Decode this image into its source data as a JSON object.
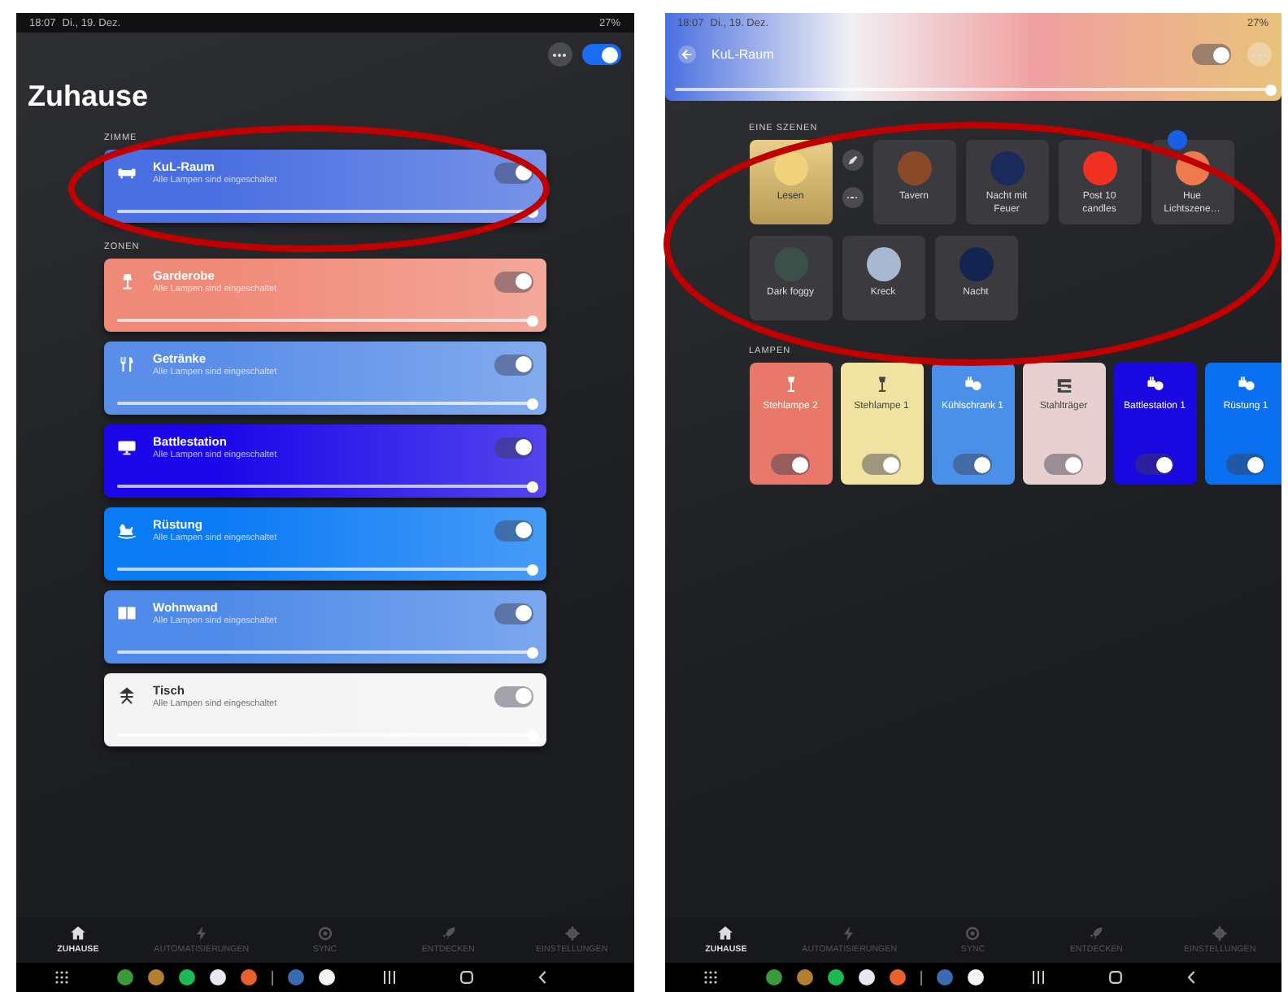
{
  "home": {
    "status_bar": {
      "time": "18:07",
      "date": "Di., 19. Dez.",
      "battery": "27%"
    },
    "title": "Zuhause",
    "all_on": true,
    "sections": [
      {
        "label": "ZIMME",
        "rooms": [
          {
            "name": "KuL-Raum",
            "subtitle": "Alle Lampen sind eingeschaltet",
            "on": true,
            "level": 1,
            "color": "#4a6fe0"
          }
        ]
      },
      {
        "label": "ZONEN",
        "rooms": [
          {
            "name": "Garderobe",
            "subtitle": "Alle Lampen sind eingeschaltet",
            "on": true,
            "level": 1,
            "color": "#f08a78"
          },
          {
            "name": "Getränke",
            "subtitle": "Alle Lampen sind eingeschaltet",
            "on": true,
            "level": 1,
            "color": "#5a8ee8"
          },
          {
            "name": "Battlestation",
            "subtitle": "Alle Lampen sind eingeschaltet",
            "on": true,
            "level": 1,
            "color": "#1a06e8"
          },
          {
            "name": "Rüstung",
            "subtitle": "Alle Lampen sind eingeschaltet",
            "on": true,
            "level": 1,
            "color": "#0a7af5"
          },
          {
            "name": "Wohnwand",
            "subtitle": "Alle Lampen sind eingeschaltet",
            "on": true,
            "level": 1,
            "color": "#4f8ae8"
          },
          {
            "name": "Tisch",
            "subtitle": "Alle Lampen sind eingeschaltet",
            "on": true,
            "level": 1,
            "color": "#f4f4f4"
          }
        ]
      }
    ],
    "nav": [
      {
        "label": "ZUHAUSE",
        "selected": true
      },
      {
        "label": "AUTOMATISIERUNGEN",
        "selected": false
      },
      {
        "label": "SYNC",
        "selected": false
      },
      {
        "label": "ENTDECKEN",
        "selected": false
      },
      {
        "label": "EINSTELLUNGEN",
        "selected": false
      }
    ]
  },
  "room": {
    "status_bar": {
      "time": "18:07",
      "date": "Di., 19. Dez.",
      "battery": "27%"
    },
    "title": "KuL-Raum",
    "on": true,
    "level": 1,
    "color": "#4a6fe0",
    "scenes_label": "EINE SZENEN",
    "scenes": [
      {
        "name": "Lesen",
        "selected": true,
        "color": "#f0d27a"
      },
      {
        "name": "Tavern",
        "selected": false,
        "color": "#8a4a2a"
      },
      {
        "name": "Nacht mit Feuer",
        "selected": false,
        "color": "#1a2a5a"
      },
      {
        "name": "Post 10 candles",
        "selected": false,
        "color": "#f03020"
      },
      {
        "name": "Hue Lichtszene…",
        "selected": false,
        "color": "#f07a50"
      },
      {
        "name": "Dark foggy",
        "selected": false,
        "color": "#3a5048"
      },
      {
        "name": "Kreck",
        "selected": false,
        "color": "#a8b8d0"
      },
      {
        "name": "Nacht",
        "selected": false,
        "color": "#142450"
      }
    ],
    "lamps_label": "LAMPEN",
    "lamps": [
      {
        "name": "Stehlampe 2",
        "kind": "floor-lamp",
        "on": true,
        "color": "#e8786a"
      },
      {
        "name": "Stehlampe 1",
        "kind": "floor-lamp",
        "on": true,
        "color": "#f0e2a0"
      },
      {
        "name": "Kühlschrank 1",
        "kind": "plug",
        "on": true,
        "color": "#4a90e8"
      },
      {
        "name": "Stahlträger",
        "kind": "strip",
        "on": true,
        "color": "#e8d0d0"
      },
      {
        "name": "Battlestation 1",
        "kind": "plug",
        "on": true,
        "color": "#1a08e0"
      },
      {
        "name": "Rüstung 1",
        "kind": "plug",
        "on": true,
        "color": "#0a70f0"
      }
    ],
    "nav": [
      {
        "label": "ZUHAUSE",
        "selected": true
      },
      {
        "label": "AUTOMATISIERUNGEN",
        "selected": false
      },
      {
        "label": "SYNC",
        "selected": false
      },
      {
        "label": "ENTDECKEN",
        "selected": false
      },
      {
        "label": "EINSTELLUNGEN",
        "selected": false
      }
    ]
  }
}
